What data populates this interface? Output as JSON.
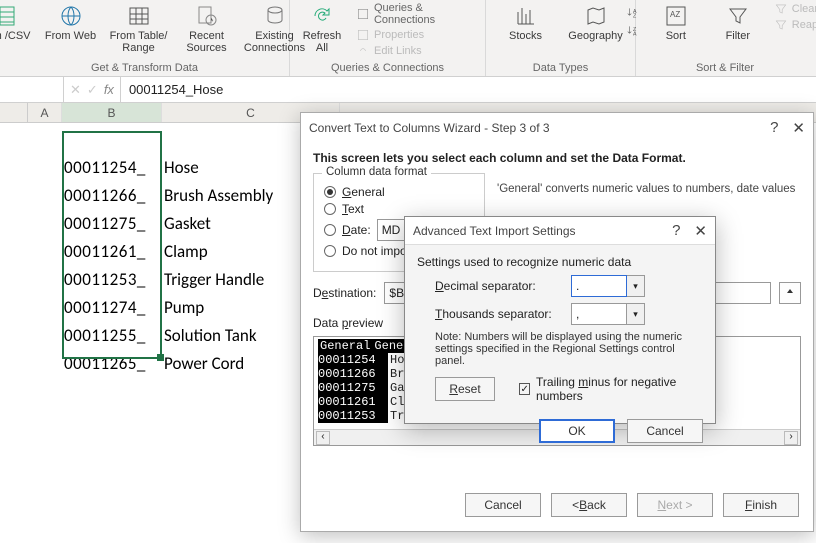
{
  "ribbon": {
    "groups": {
      "get_transform": {
        "label": "Get & Transform Data",
        "btns": {
          "csv": "om\n/CSV",
          "web": "From\nWeb",
          "table": "From Table/\nRange",
          "recent": "Recent\nSources",
          "existing": "Existing\nConnections"
        }
      },
      "queries": {
        "label": "Queries & Connections",
        "refresh": "Refresh\nAll",
        "items": {
          "qc": "Queries & Connections",
          "props": "Properties",
          "links": "Edit Links"
        }
      },
      "datatypes": {
        "label": "Data Types",
        "stocks": "Stocks",
        "geo": "Geography"
      },
      "sortfilter": {
        "label": "Sort & Filter",
        "sort": "Sort",
        "filter": "Filter",
        "clear": "Clear",
        "reapp": "Reapp"
      }
    }
  },
  "formula_bar": {
    "name_box": "",
    "value": "00011254_Hose"
  },
  "columns": [
    "A",
    "B",
    "C"
  ],
  "rows": [
    {
      "num": "00011254_",
      "txt": "Hose"
    },
    {
      "num": "00011266_",
      "txt": "Brush Assembly"
    },
    {
      "num": "00011275_",
      "txt": "Gasket"
    },
    {
      "num": "00011261_",
      "txt": "Clamp"
    },
    {
      "num": "00011253_",
      "txt": "Trigger Handle"
    },
    {
      "num": "00011274_",
      "txt": "Pump"
    },
    {
      "num": "00011255_",
      "txt": "Solution Tank"
    },
    {
      "num": "00011265_",
      "txt": "Power Cord"
    }
  ],
  "wizard": {
    "title": "Convert Text to Columns Wizard - Step 3 of 3",
    "intro": "This screen lets you select each column and set the Data Format.",
    "group_label": "Column data format",
    "radios": {
      "general": "General",
      "text": "Text",
      "date": "Date:",
      "date_val": "MD",
      "skip": "Do not impo"
    },
    "note": "'General' converts numeric values to numbers, date values",
    "dest_label": "Destination:",
    "dest_value": "$B",
    "preview_label": "Data preview",
    "preview_header": [
      "General",
      "General"
    ],
    "preview_rows": [
      [
        "00011254",
        "Hose"
      ],
      [
        "00011266",
        "Brush"
      ],
      [
        "00011275",
        "Gasket"
      ],
      [
        "00011261",
        "Clamp"
      ],
      [
        "00011253",
        "Trigger Handle"
      ]
    ],
    "buttons": {
      "cancel": "Cancel",
      "back": "< Back",
      "next": "Next >",
      "finish": "Finish"
    }
  },
  "advanced": {
    "title": "Advanced Text Import Settings",
    "heading": "Settings used to recognize numeric data",
    "decimal_label": "Decimal separator:",
    "decimal_value": ".",
    "thousands_label": "Thousands separator:",
    "thousands_value": ",",
    "note": "Note: Numbers will be displayed using the numeric settings specified in the Regional Settings control panel.",
    "reset": "Reset",
    "trailing": "Trailing minus for negative numbers",
    "ok": "OK",
    "cancel": "Cancel"
  }
}
